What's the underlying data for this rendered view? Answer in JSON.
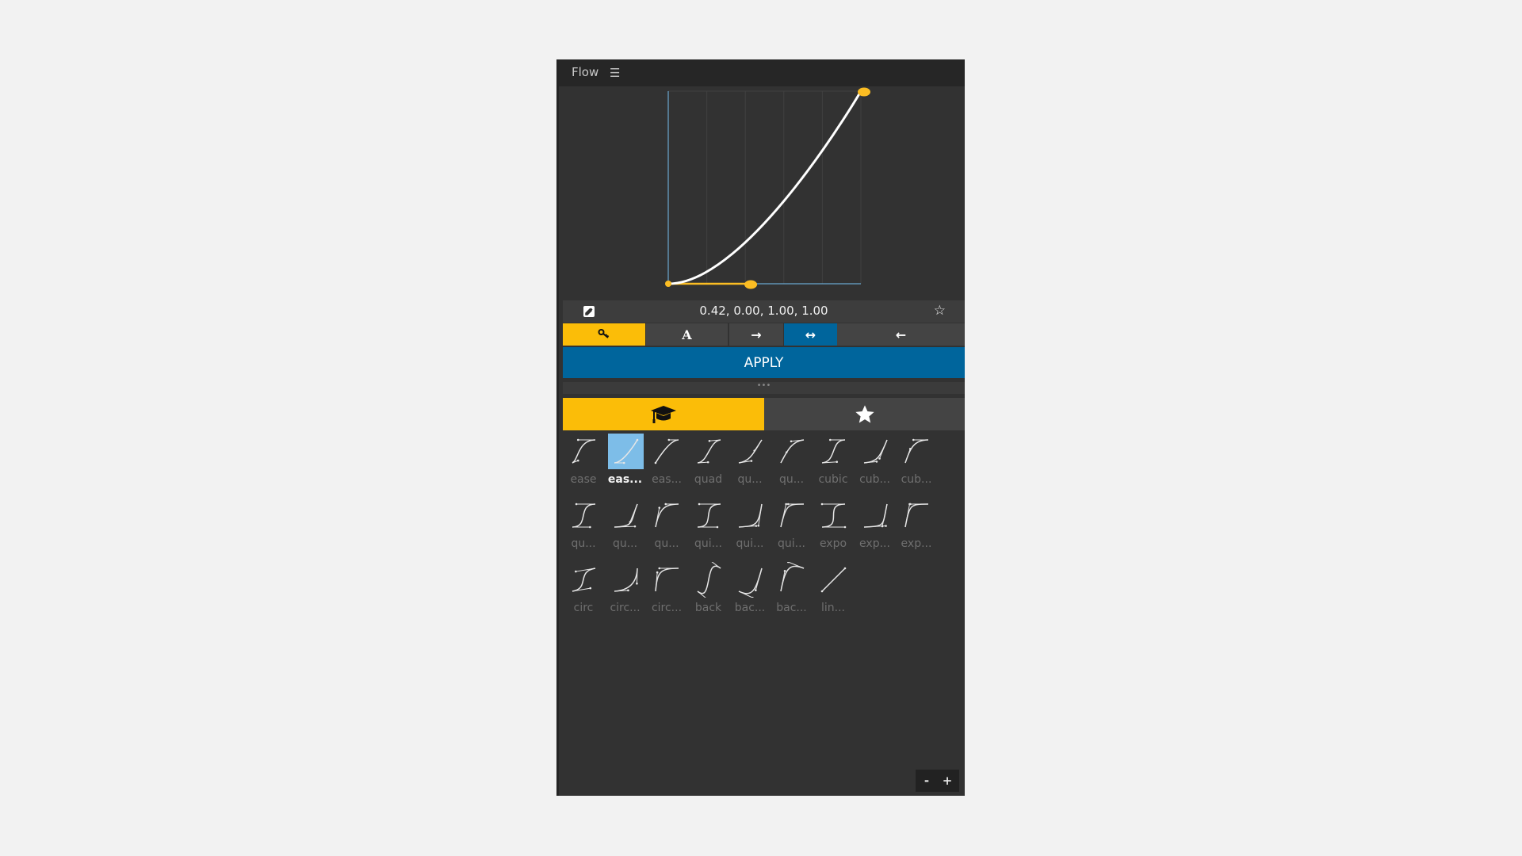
{
  "panel": {
    "title": "Flow",
    "menu_icon": "hamburger-menu-icon"
  },
  "curve": {
    "bezier": [
      0.42,
      0.0,
      1.0,
      1.0
    ],
    "value_text": "0.42, 0.00, 1.00, 1.00",
    "grid_columns": 5,
    "colors": {
      "curve": "#ffffff",
      "handle": "#fbbd23",
      "axis": "#6aa7cf",
      "grid": "#404040"
    }
  },
  "valuebar": {
    "edit_icon": "edit-icon",
    "favorite_icon": "star-outline-icon"
  },
  "toolbar": {
    "buttons": [
      {
        "name": "keyframe-mode",
        "glyph": "🔑︎",
        "icon": "key-icon",
        "active": true,
        "color": "#fbbd08"
      },
      {
        "name": "text-mode",
        "glyph": "A",
        "icon": "text-icon",
        "active": false
      },
      {
        "name": "ease-in",
        "glyph": "→",
        "icon": "arrow-right-icon",
        "active": false
      },
      {
        "name": "ease-both",
        "glyph": "↔",
        "icon": "arrow-both-icon",
        "active": true,
        "color": "#00659c"
      },
      {
        "name": "ease-out",
        "glyph": "←",
        "icon": "arrow-left-icon",
        "active": false
      }
    ]
  },
  "apply": {
    "label": "APPLY"
  },
  "divider": {
    "glyph": "•••"
  },
  "tabs": [
    {
      "name": "presets",
      "icon": "graduation-cap-icon",
      "active": true
    },
    {
      "name": "favorites",
      "icon": "star-icon",
      "active": false
    }
  ],
  "presets": [
    {
      "label": "ease",
      "curve": [
        0.25,
        0.1,
        0.25,
        1
      ]
    },
    {
      "label": "eas...",
      "curve": [
        0.42,
        0,
        1,
        1
      ],
      "selected": true
    },
    {
      "label": "eas...",
      "curve": [
        0,
        0,
        0.58,
        1
      ]
    },
    {
      "label": "quad",
      "curve": [
        0.455,
        0.03,
        0.515,
        0.955
      ]
    },
    {
      "label": "qu...",
      "curve": [
        0.55,
        0.085,
        0.68,
        0.53
      ]
    },
    {
      "label": "qu...",
      "curve": [
        0.25,
        0.46,
        0.45,
        0.94
      ]
    },
    {
      "label": "cubic",
      "curve": [
        0.645,
        0.045,
        0.355,
        1
      ]
    },
    {
      "label": "cub...",
      "curve": [
        0.55,
        0.055,
        0.675,
        0.19
      ]
    },
    {
      "label": "cub...",
      "curve": [
        0.215,
        0.61,
        0.355,
        1
      ]
    },
    {
      "label": "qu...",
      "curve": [
        0.77,
        0,
        0.175,
        1
      ]
    },
    {
      "label": "qu...",
      "curve": [
        0.895,
        0.03,
        0.685,
        0.22
      ]
    },
    {
      "label": "qu...",
      "curve": [
        0.165,
        0.84,
        0.44,
        1
      ]
    },
    {
      "label": "qui...",
      "curve": [
        0.86,
        0,
        0.07,
        1
      ]
    },
    {
      "label": "qui...",
      "curve": [
        0.755,
        0.05,
        0.855,
        0.06
      ]
    },
    {
      "label": "qui...",
      "curve": [
        0.23,
        1,
        0.32,
        1
      ]
    },
    {
      "label": "expo",
      "curve": [
        1,
        0,
        0,
        1
      ]
    },
    {
      "label": "exp...",
      "curve": [
        0.95,
        0.05,
        0.795,
        0.035
      ]
    },
    {
      "label": "exp...",
      "curve": [
        0.19,
        1,
        0.22,
        1
      ]
    },
    {
      "label": "circ",
      "curve": [
        0.785,
        0.135,
        0.15,
        0.86
      ]
    },
    {
      "label": "circ...",
      "curve": [
        0.6,
        0.04,
        0.98,
        0.335
      ]
    },
    {
      "label": "circ...",
      "curve": [
        0.075,
        0.82,
        0.165,
        1
      ]
    },
    {
      "label": "back",
      "curve": [
        0.68,
        -0.55,
        0.265,
        1.55
      ]
    },
    {
      "label": "bac...",
      "curve": [
        0.6,
        -0.28,
        0.735,
        0.045
      ]
    },
    {
      "label": "bac...",
      "curve": [
        0.175,
        0.885,
        0.32,
        1.275
      ]
    },
    {
      "label": "lin...",
      "curve": [
        0,
        0,
        1,
        1
      ]
    }
  ],
  "zoom": {
    "minus": "-",
    "plus": "+"
  }
}
